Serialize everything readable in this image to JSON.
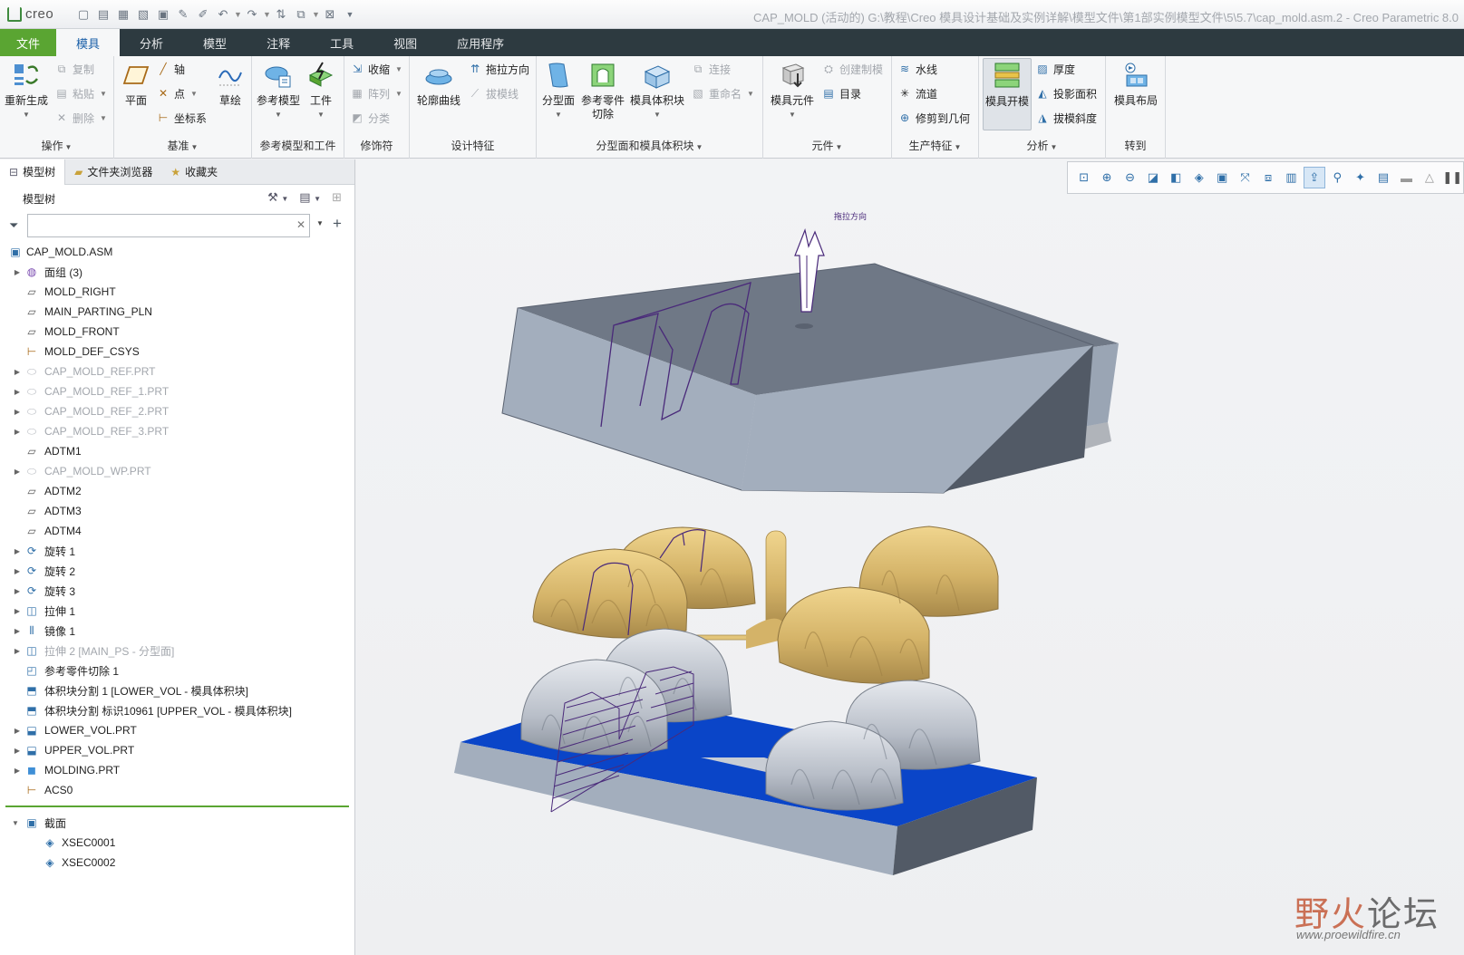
{
  "app": {
    "logo": "creo",
    "window_title": "CAP_MOLD (活动的) G:\\教程\\Creo 模具设计基础及实例详解\\模型文件\\第1部实例模型文件\\5\\5.7\\cap_mold.asm.2 - Creo Parametric 8.0"
  },
  "tabs": [
    {
      "label": "文件"
    },
    {
      "label": "模具"
    },
    {
      "label": "分析"
    },
    {
      "label": "模型"
    },
    {
      "label": "注释"
    },
    {
      "label": "工具"
    },
    {
      "label": "视图"
    },
    {
      "label": "应用程序"
    }
  ],
  "ribbon": {
    "ops": {
      "label": "操作",
      "regen": "重新生成",
      "copy": "复制",
      "paste": "粘贴",
      "delete": "删除"
    },
    "datum": {
      "label": "基准",
      "plane": "平面",
      "axis": "轴",
      "point": "点",
      "csys": "坐标系",
      "sketch": "草绘"
    },
    "refmodel": {
      "label": "参考模型和工件",
      "ref_model": "参考模型",
      "workpiece": "工件"
    },
    "decor": {
      "label": "修饰符",
      "shrink": "收缩",
      "pattern": "阵列",
      "classify": "分类"
    },
    "design": {
      "label": "设计特征",
      "silhouette": "轮廓曲线",
      "draw_dir": "拖拉方向",
      "draft_line": "拔模线"
    },
    "parting": {
      "label": "分型面和模具体积块",
      "parting_surface": "分型面",
      "ref_cut_1": "参考零件",
      "ref_cut_2": "切除",
      "mold_volume": "模具体积块",
      "connect": "连接",
      "rename": "重命名"
    },
    "component": {
      "label": "元件",
      "mold_component": "模具元件",
      "create_casting": "创建制模",
      "bom": "目录"
    },
    "production": {
      "label": "生产特征",
      "waterline": "水线",
      "runner": "流道",
      "trim_geom": "修剪到几何"
    },
    "analysis": {
      "label": "分析",
      "mold_open": "模具开模",
      "thickness": "厚度",
      "proj_area": "投影面积",
      "draft_slope": "拔模斜度"
    },
    "goto": {
      "label": "转到",
      "mold_layout": "模具布局"
    }
  },
  "panel": {
    "tabs": [
      {
        "label": "模型树"
      },
      {
        "label": "文件夹浏览器"
      },
      {
        "label": "收藏夹"
      }
    ],
    "tree_title": "模型树",
    "search_value": ""
  },
  "tree": [
    {
      "label": "CAP_MOLD.ASM",
      "icon": "assembly-icon",
      "expander": "",
      "disabled": false
    },
    {
      "label": "面组 (3)",
      "icon": "quilt-icon",
      "expander": "▶",
      "disabled": false
    },
    {
      "label": "MOLD_RIGHT",
      "icon": "datum-plane-icon",
      "expander": "",
      "disabled": false
    },
    {
      "label": "MAIN_PARTING_PLN",
      "icon": "datum-plane-icon",
      "expander": "",
      "disabled": false
    },
    {
      "label": "MOLD_FRONT",
      "icon": "datum-plane-icon",
      "expander": "",
      "disabled": false
    },
    {
      "label": "MOLD_DEF_CSYS",
      "icon": "csys-icon",
      "expander": "",
      "disabled": false
    },
    {
      "label": "CAP_MOLD_REF.PRT",
      "icon": "part-icon",
      "expander": "▶",
      "disabled": true
    },
    {
      "label": "CAP_MOLD_REF_1.PRT",
      "icon": "part-icon",
      "expander": "▶",
      "disabled": true
    },
    {
      "label": "CAP_MOLD_REF_2.PRT",
      "icon": "part-icon",
      "expander": "▶",
      "disabled": true
    },
    {
      "label": "CAP_MOLD_REF_3.PRT",
      "icon": "part-icon",
      "expander": "▶",
      "disabled": true
    },
    {
      "label": "ADTM1",
      "icon": "datum-plane-icon",
      "expander": "",
      "disabled": false
    },
    {
      "label": "CAP_MOLD_WP.PRT",
      "icon": "part-icon",
      "expander": "▶",
      "disabled": true
    },
    {
      "label": "ADTM2",
      "icon": "datum-plane-icon",
      "expander": "",
      "disabled": false
    },
    {
      "label": "ADTM3",
      "icon": "datum-plane-icon",
      "expander": "",
      "disabled": false
    },
    {
      "label": "ADTM4",
      "icon": "datum-plane-icon",
      "expander": "",
      "disabled": false
    },
    {
      "label": "旋转 1",
      "icon": "revolve-icon",
      "expander": "▶",
      "disabled": false
    },
    {
      "label": "旋转 2",
      "icon": "revolve-icon",
      "expander": "▶",
      "disabled": false
    },
    {
      "label": "旋转 3",
      "icon": "revolve-icon",
      "expander": "▶",
      "disabled": false
    },
    {
      "label": "拉伸 1",
      "icon": "extrude-icon",
      "expander": "▶",
      "disabled": false
    },
    {
      "label": "镜像 1",
      "icon": "mirror-icon",
      "expander": "▶",
      "disabled": false
    },
    {
      "label": "拉伸 2 [MAIN_PS - 分型面]",
      "icon": "extrude-icon",
      "expander": "▶",
      "disabled": true
    },
    {
      "label": "参考零件切除 1",
      "icon": "ref-cut-icon",
      "expander": "",
      "disabled": false
    },
    {
      "label": "体积块分割 1 [LOWER_VOL - 模具体积块]",
      "icon": "volume-split-icon",
      "expander": "",
      "disabled": false
    },
    {
      "label": "体积块分割 标识10961 [UPPER_VOL - 模具体积块]",
      "icon": "volume-split-icon",
      "expander": "",
      "disabled": false
    },
    {
      "label": "LOWER_VOL.PRT",
      "icon": "volume-part-icon",
      "expander": "▶",
      "disabled": false
    },
    {
      "label": "UPPER_VOL.PRT",
      "icon": "volume-part-icon",
      "expander": "▶",
      "disabled": false
    },
    {
      "label": "MOLDING.PRT",
      "icon": "molding-part-icon",
      "expander": "▶",
      "disabled": false
    },
    {
      "label": "ACS0",
      "icon": "csys-icon",
      "expander": "",
      "disabled": false
    }
  ],
  "sections": {
    "label": "截面",
    "items": [
      {
        "label": "XSEC0001"
      },
      {
        "label": "XSEC0002"
      }
    ]
  },
  "viewport": {
    "annotation": "拖拉方向"
  },
  "watermark": {
    "brand_a": "野火",
    "brand_b": "论坛",
    "url": "www.proewildfire.cn"
  },
  "colors": {
    "file_tab": "#5aa532",
    "tab_bar": "#2d3a40",
    "active_tab_text": "#1a5fa8",
    "workpiece_gray": "#a3aebd",
    "molding_gold": "#d4b368",
    "parting_blue": "#0a45c8",
    "sketch_purple": "#4a2a7a"
  }
}
